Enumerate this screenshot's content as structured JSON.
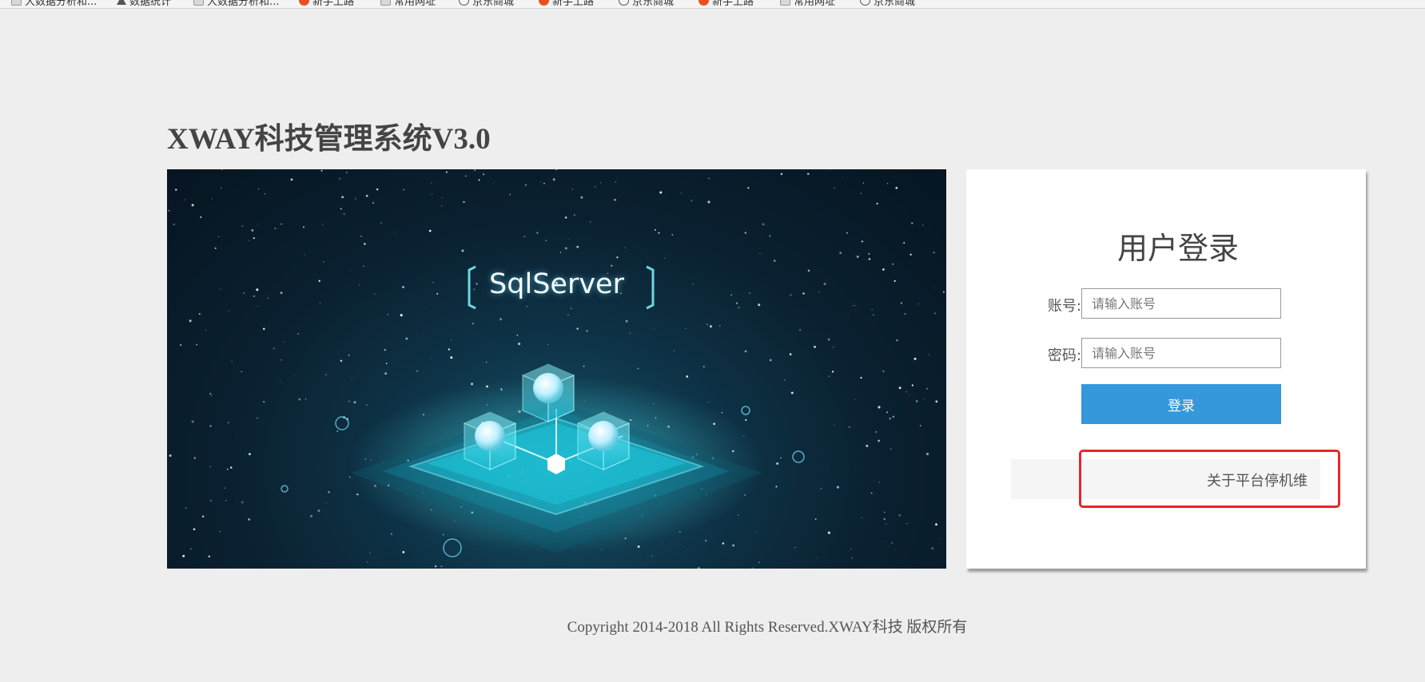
{
  "bookmarks": [
    {
      "label": "大数据分析和...",
      "icon": "folder-icon"
    },
    {
      "label": "数据统计",
      "icon": "star-icon"
    },
    {
      "label": "大数据分析和...",
      "icon": "folder-icon"
    },
    {
      "label": "新手上路",
      "icon": "fire-icon"
    },
    {
      "label": "常用网址",
      "icon": "folder-icon"
    },
    {
      "label": "京东商城",
      "icon": "globe-icon"
    },
    {
      "label": "新手上路",
      "icon": "fire-icon"
    },
    {
      "label": "京东商城",
      "icon": "globe-icon"
    },
    {
      "label": "新手上路",
      "icon": "fire-icon"
    },
    {
      "label": "常用网址",
      "icon": "folder-icon"
    },
    {
      "label": "京东商城",
      "icon": "globe-icon"
    }
  ],
  "page": {
    "title": "XWAY科技管理系统V3.0"
  },
  "banner": {
    "label": "SqlServer"
  },
  "login": {
    "heading": "用户登录",
    "account_label": "账号:",
    "account_placeholder": "请输入账号",
    "password_label": "密码:",
    "password_placeholder": "请输入账号",
    "submit_label": "登录",
    "notice_link": "关于平台停机维"
  },
  "footer": {
    "copyright": "Copyright 2014-2018 All Rights Reserved.XWAY科技 版权所有"
  },
  "colors": {
    "background": "#eeeeee",
    "button": "#3498db",
    "highlight": "#e8262a"
  }
}
